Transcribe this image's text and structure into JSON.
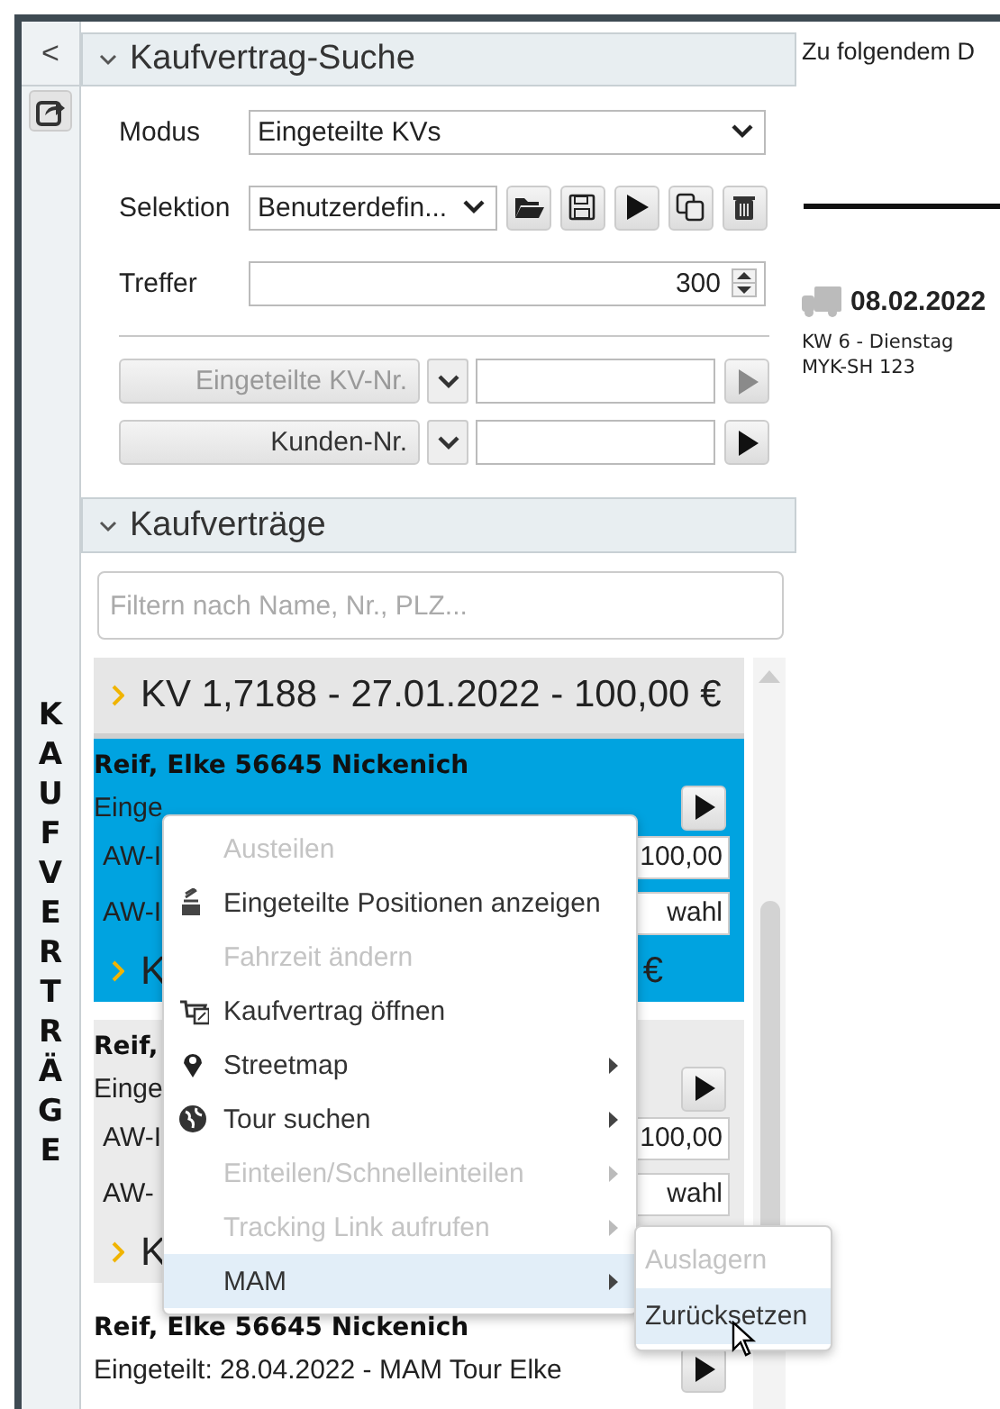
{
  "sidebar": {
    "collapse": "<",
    "vertical_title": "KAUFVERTRÄGE"
  },
  "search": {
    "title": "Kaufvertrag-Suche",
    "expanded": true,
    "fields": [
      {
        "kind": "select",
        "label": "Modus",
        "value": "Eingeteilte KVs"
      },
      {
        "kind": "selection",
        "label": "Selektion",
        "value": "Benutzerdefin..."
      },
      {
        "kind": "number",
        "label": "Treffer",
        "value": "300"
      }
    ],
    "filters": [
      {
        "label": "Eingeteilte KV-Nr.",
        "disabled": true
      },
      {
        "label": "Kunden-Nr.",
        "disabled": false
      }
    ]
  },
  "contracts": {
    "title": "Kaufverträge",
    "expanded": true,
    "filter": {
      "placeholder": "Filtern nach Name, Nr., PLZ..."
    },
    "group": {
      "label": "KV 1,7188 - 27.01.2022 - 100,00 €"
    },
    "cards": [
      {
        "selected": true,
        "hovered": false,
        "name": "Reif, Elke 56645 Nickenich",
        "assigned": "Einge",
        "rows": [
          {
            "label": "AW-I",
            "value": "100,00"
          },
          {
            "label": "AW-I",
            "value": "wahl"
          }
        ],
        "kv_start": "K",
        "kv_end": "€"
      },
      {
        "selected": false,
        "hovered": true,
        "name": "Reif,",
        "assigned": "Einge",
        "rows": [
          {
            "label": "AW-I",
            "value": "100,00"
          },
          {
            "label": "AW-",
            "value": "wahl"
          }
        ],
        "kv_start": "K"
      },
      {
        "selected": false,
        "hovered": false,
        "name": "Reif, Elke 56645 Nickenich",
        "assigned": "Eingeteilt: 28.04.2022 - MAM Tour Elke"
      }
    ]
  },
  "context_menu": {
    "items": [
      {
        "kind": "plain",
        "label": "Austeilen",
        "disabled": true,
        "submenu": false,
        "selected": false
      },
      {
        "kind": "positions",
        "label": "Eingeteilte Positionen anzeigen",
        "disabled": false,
        "submenu": false,
        "selected": false
      },
      {
        "kind": "plain",
        "label": "Fahrzeit ändern",
        "disabled": true,
        "submenu": false,
        "selected": false
      },
      {
        "kind": "contract",
        "label": "Kaufvertrag öffnen",
        "disabled": false,
        "submenu": false,
        "selected": false
      },
      {
        "kind": "map",
        "label": "Streetmap",
        "disabled": false,
        "submenu": true,
        "selected": false
      },
      {
        "kind": "tour",
        "label": "Tour suchen",
        "disabled": false,
        "submenu": true,
        "selected": false
      },
      {
        "kind": "plain",
        "label": "Einteilen/Schnelleinteilen",
        "disabled": true,
        "submenu": true,
        "selected": false
      },
      {
        "kind": "plain",
        "label": "Tracking Link aufrufen",
        "disabled": true,
        "submenu": true,
        "selected": false
      },
      {
        "kind": "plain",
        "label": "MAM",
        "disabled": false,
        "submenu": true,
        "selected": true
      }
    ]
  },
  "submenu": {
    "items": [
      {
        "label": "Auslagern",
        "disabled": true,
        "selected": false
      },
      {
        "label": "Zurücksetzen",
        "disabled": false,
        "selected": true
      }
    ]
  },
  "detail": {
    "heading": "Zu folgendem D",
    "date": "08.02.2022",
    "week": "KW 6 - Dienstag",
    "plate": "MYK-SH 123"
  }
}
